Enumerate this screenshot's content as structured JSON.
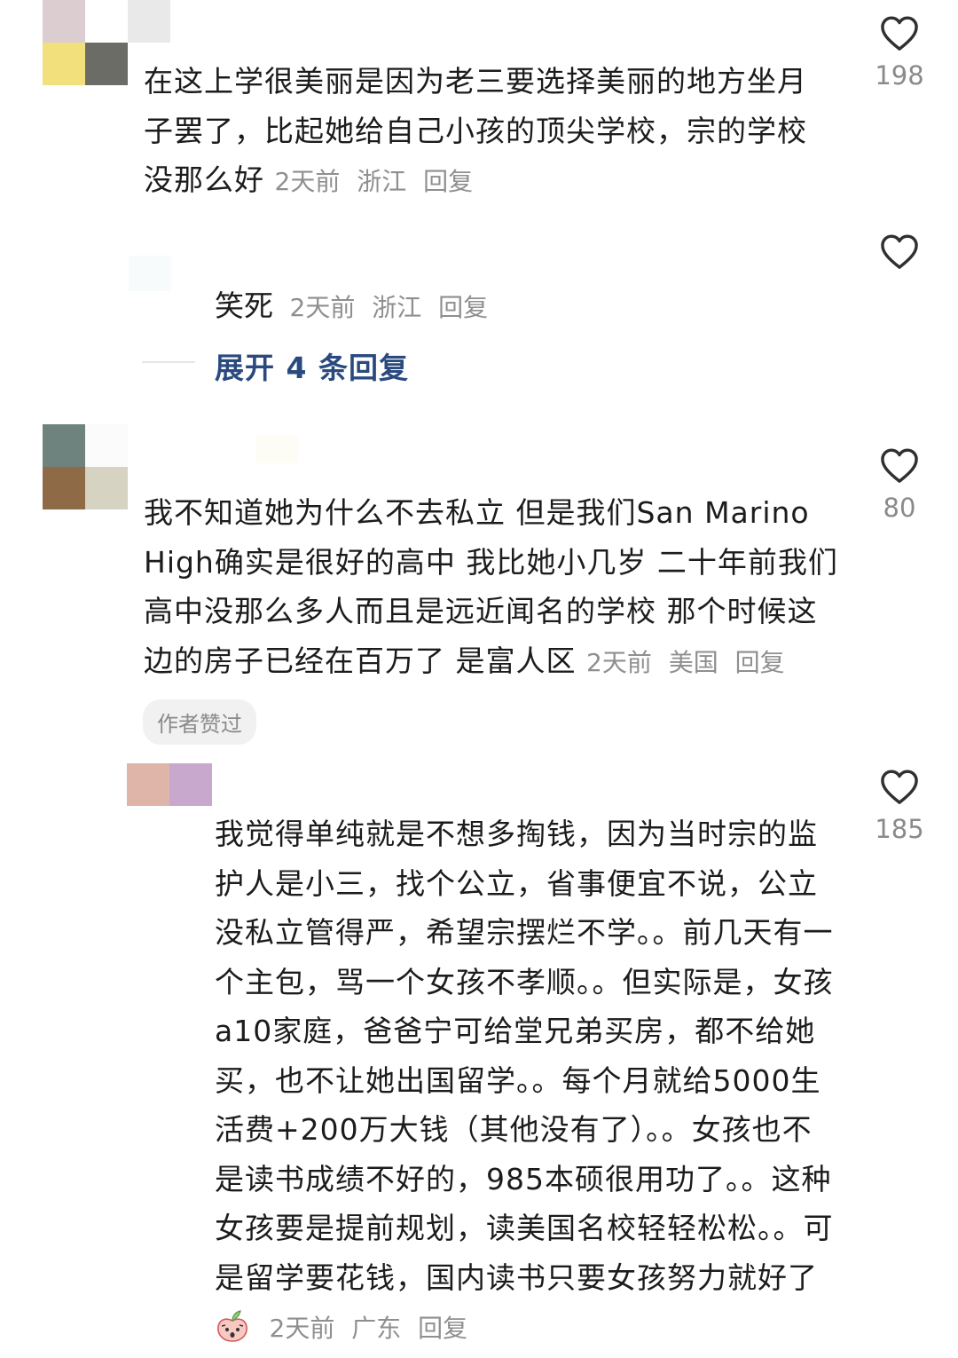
{
  "comments": [
    {
      "text": "在这上学很美丽是因为老三要选择美丽的地方坐月子罢了，比起她给自己小孩的顶尖学校，宗的学校没那么好",
      "time": "2天前",
      "location": "浙江",
      "reply_label": "回复",
      "likes": "198",
      "avatar_colors": [
        "#dccdd0",
        "#ffffff",
        "#e9e9e9",
        "#f1e07c",
        "#6c6c66"
      ]
    },
    {
      "text": "笑死",
      "time": "2天前",
      "location": "浙江",
      "reply_label": "回复"
    },
    {
      "text": "我不知道她为什么不去私立 但是我们San Marino High确实是很好的高中 我比她小几岁 二十年前我们高中没那么多人而且是远近闻名的学校 那个时候这边的房子已经在百万了 是富人区",
      "time": "2天前",
      "location": "美国",
      "reply_label": "回复",
      "likes": "80",
      "badge": "作者赞过",
      "avatar_colors": [
        "#6e837e",
        "#fbfbfb",
        "#8f6a46",
        "#d7d3c2"
      ]
    },
    {
      "text": "我觉得单纯就是不想多掏钱，因为当时宗的监护人是小三，找个公立，省事便宜不说，公立没私立管得严，希望宗摆烂不学。。前几天有一个主包，骂一个女孩不孝顺。。但实际是，女孩a10家庭，爸爸宁可给堂兄弟买房，都不给她买，也不让她出国留学。。每个月就给5000生活费+200万大钱（其他没有了）。。女孩也不是读书成绩不好的，985本硕很用功了。。这种女孩要是提前规划，读美国名校轻轻松松。。可是留学要花钱，国内读书只要女孩努力就好了",
      "time": "2天前",
      "location": "广东",
      "reply_label": "回复",
      "likes": "185",
      "avatar_colors": [
        "#e0b5a9",
        "#c8a8cd"
      ]
    }
  ],
  "expand_replies": "展开 4 条回复",
  "icons": {
    "like": "heart-outline-icon",
    "emoji": "peach-emoji-icon"
  }
}
